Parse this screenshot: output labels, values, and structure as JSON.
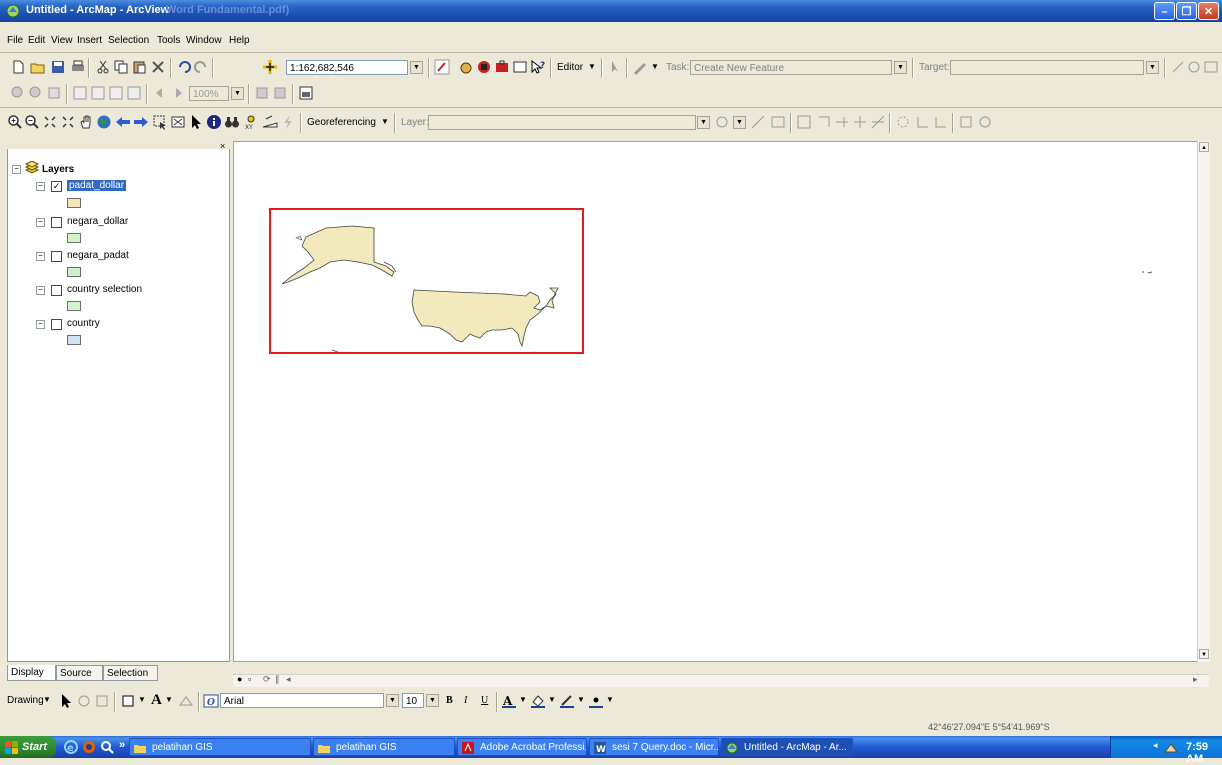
{
  "window": {
    "title": "Untitled - ArcMap - ArcView",
    "ghost_text": "Word Fundamental.pdf)",
    "controls": {
      "minimize": "–",
      "maximize": "❐",
      "close": "✕"
    }
  },
  "menu": [
    "File",
    "Edit",
    "View",
    "Insert",
    "Selection",
    "Tools",
    "Window",
    "Help"
  ],
  "standard_toolbar": {
    "scale": "1:162,682,546",
    "editor_label": "Editor",
    "task_label": "Task:",
    "task_value": "Create New Feature",
    "target_label": "Target:",
    "target_value": ""
  },
  "layout_toolbar": {
    "zoom": "100%"
  },
  "tools_toolbar": {
    "georef_label": "Georeferencing",
    "layer_label": "Layer:",
    "layer_value": ""
  },
  "toc": {
    "root": "Layers",
    "layers": [
      {
        "name": "padat_dollar",
        "checked": true,
        "swatch": "#f0e6b9",
        "selected": true
      },
      {
        "name": "negara_dollar",
        "checked": false,
        "swatch": "#d7f1c9"
      },
      {
        "name": "negara_padat",
        "checked": false,
        "swatch": "#c9f2cc"
      },
      {
        "name": "country selection",
        "checked": false,
        "swatch": "#d1f4d1"
      },
      {
        "name": "country",
        "checked": false,
        "swatch": "#cfe2f3"
      }
    ],
    "tabs": [
      "Display",
      "Source",
      "Selection"
    ]
  },
  "map": {
    "highlight_color": "#e31a1c",
    "feature_fill": "#f2e9bd"
  },
  "drawing_toolbar": {
    "drawing_label": "Drawing",
    "font": "Arial",
    "font_size": "10",
    "bold": "B",
    "italic": "I",
    "underline": "U"
  },
  "status": {
    "coordinates": "42°46'27.094\"E  5°54'41.969\"S"
  },
  "taskbar": {
    "start": "Start",
    "tasks": [
      "pelatihan GIS",
      "pelatihan GIS",
      "Adobe Acrobat Professi...",
      "sesi 7 Query.doc - Micr...",
      "Untitled - ArcMap - Ar..."
    ],
    "clock": "7:59 AM"
  }
}
